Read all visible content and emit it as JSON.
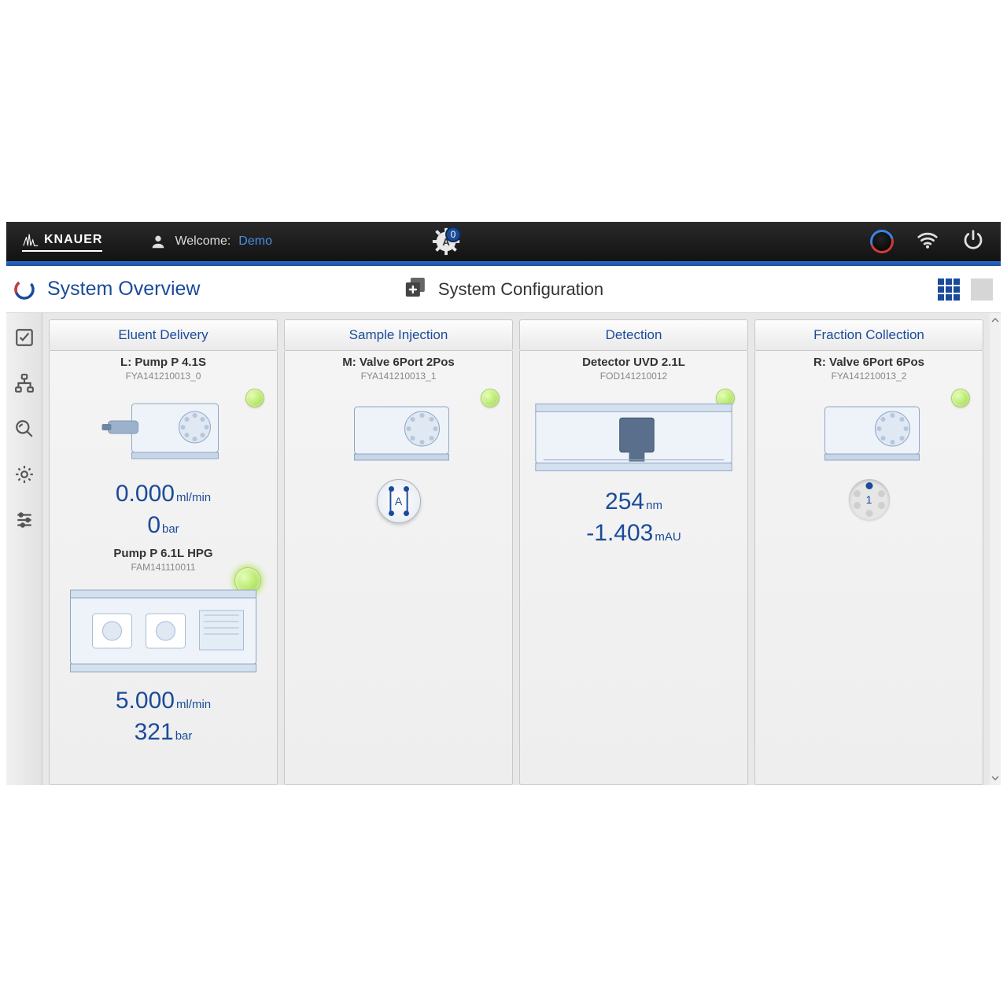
{
  "brand": "KNAUER",
  "header": {
    "welcome_label": "Welcome:",
    "user": "Demo",
    "alert_count": "0"
  },
  "page": {
    "title": "System Overview",
    "config_label": "System Configuration"
  },
  "columns": [
    {
      "title": "Eluent Delivery",
      "devices": [
        {
          "name": "L: Pump P 4.1S",
          "serial": "FYA141210013_0",
          "readings": [
            {
              "value": "0.000",
              "unit": "ml/min"
            },
            {
              "value": "0",
              "unit": "bar"
            }
          ]
        },
        {
          "name": "Pump P 6.1L HPG",
          "serial": "FAM141110011",
          "readings": [
            {
              "value": "5.000",
              "unit": "ml/min"
            },
            {
              "value": "321",
              "unit": "bar"
            }
          ]
        }
      ]
    },
    {
      "title": "Sample Injection",
      "devices": [
        {
          "name": "M: Valve 6Port 2Pos",
          "serial": "FYA141210013_1",
          "position_label": "A"
        }
      ]
    },
    {
      "title": "Detection",
      "devices": [
        {
          "name": "Detector UVD 2.1L",
          "serial": "FOD141210012",
          "readings": [
            {
              "value": "254",
              "unit": "nm"
            },
            {
              "value": "-1.403",
              "unit": "mAU"
            }
          ]
        }
      ]
    },
    {
      "title": "Fraction Collection",
      "devices": [
        {
          "name": "R: Valve 6Port 6Pos",
          "serial": "FYA141210013_2",
          "position_label": "1"
        }
      ]
    }
  ]
}
